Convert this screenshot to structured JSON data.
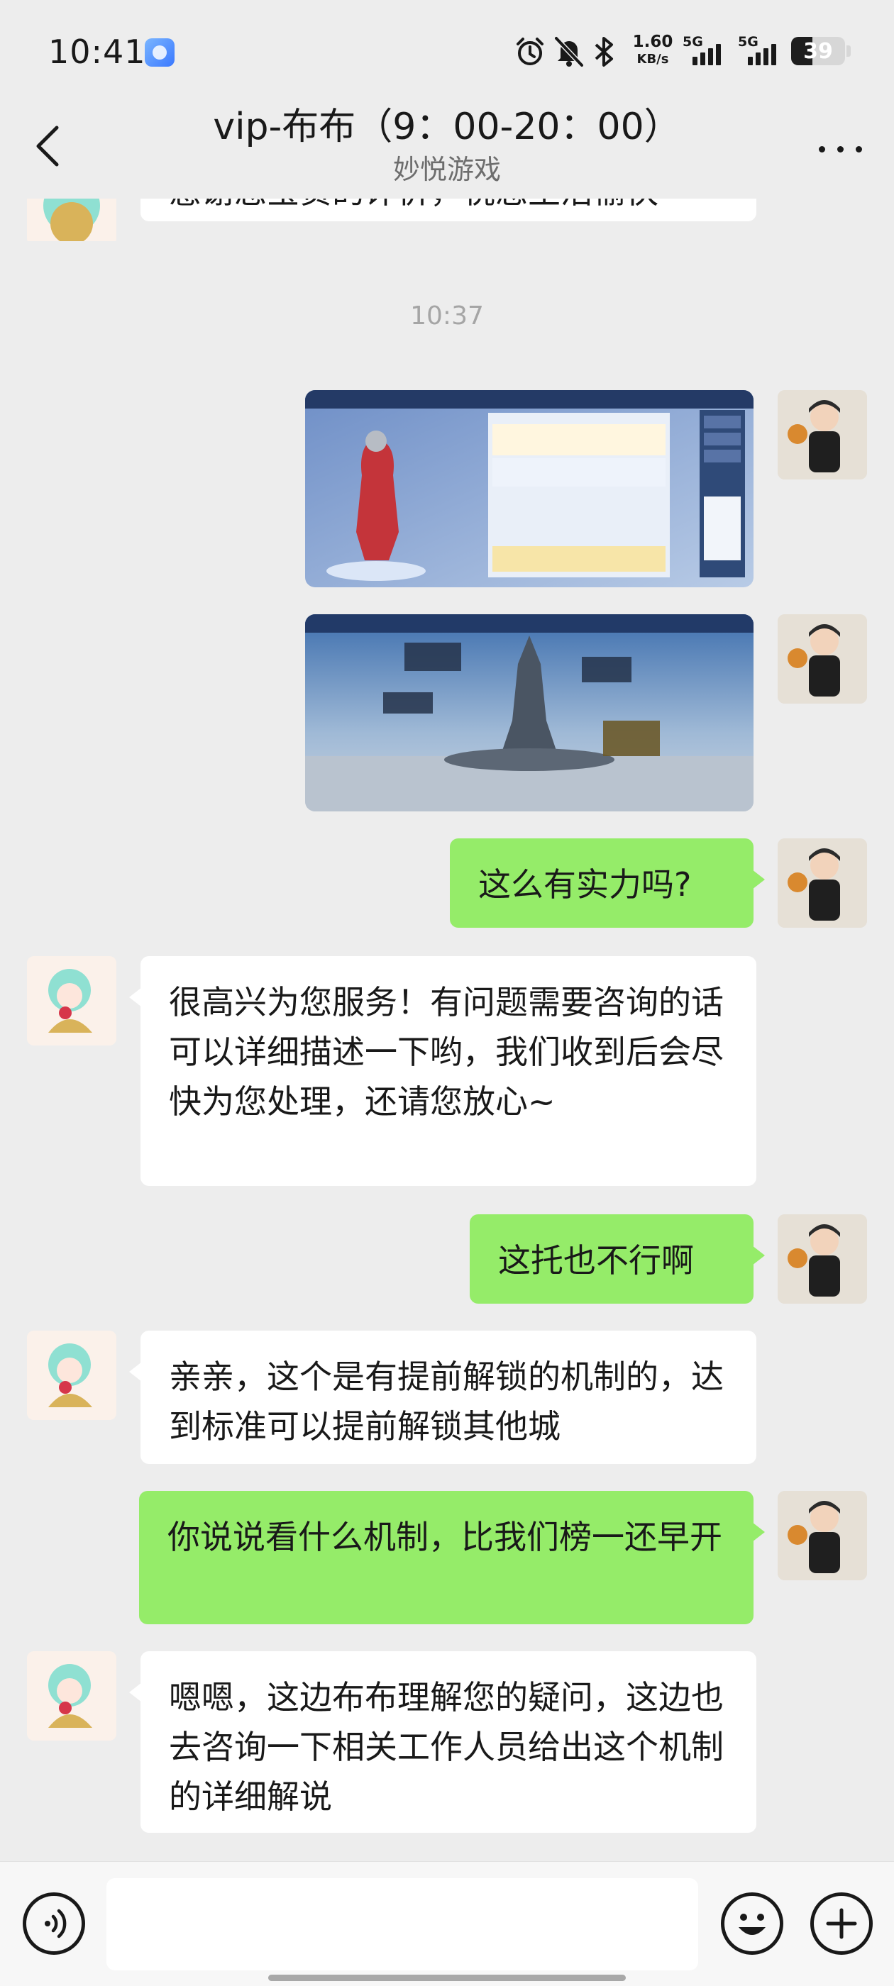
{
  "status_bar": {
    "time": "10:41",
    "net_speed_value": "1.60",
    "net_speed_unit": "KB/s",
    "sim1_label": "5G",
    "sim2_label": "5G",
    "battery_level": "39",
    "icons": [
      "app-notification-icon",
      "alarm-icon",
      "mute-icon",
      "bluetooth-icon",
      "signal-icon",
      "battery-icon"
    ]
  },
  "header": {
    "title": "vip-布布（9：00-20：00）",
    "subtitle": "妙悦游戏"
  },
  "messages": {
    "partial_top_text": "感谢您宝贵的评价，祝您生活愉快",
    "timestamp": "10:37",
    "user_q1": "这么有实力吗?",
    "agent_a1": "很高兴为您服务！有问题需要咨询的话可以详细描述一下哟，我们收到后会尽快为您处理，还请您放心~",
    "user_q2": "这托也不行啊",
    "agent_a2": "亲亲，这个是有提前解锁的机制的，达到标准可以提前解锁其他城",
    "user_q3": "你说说看什么机制，比我们榜一还早开",
    "agent_a3": "嗯嗯，这边布布理解您的疑问，这边也去咨询一下相关工作人员给出这个机制的详细解说"
  },
  "input": {
    "placeholder": ""
  },
  "colors": {
    "background": "#ededed",
    "self_bubble": "#95ec69",
    "other_bubble": "#ffffff",
    "timestamp": "#a5a5a5"
  }
}
